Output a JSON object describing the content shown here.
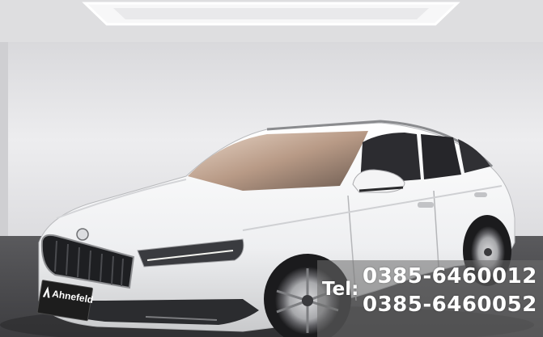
{
  "photo": {
    "subject": "white-station-wagon",
    "colors": {
      "wall": "#e8e8ea",
      "floor": "#4b4b4e",
      "body": "#f2f3f4",
      "glass": "#2c2c30",
      "ceiling_light": "#ffffff"
    }
  },
  "dealer_plate": {
    "text": "Ahnefeld"
  },
  "contact": {
    "label": "Tel:",
    "phone_1": "0385-6460012",
    "phone_2": "0385-6460052"
  }
}
